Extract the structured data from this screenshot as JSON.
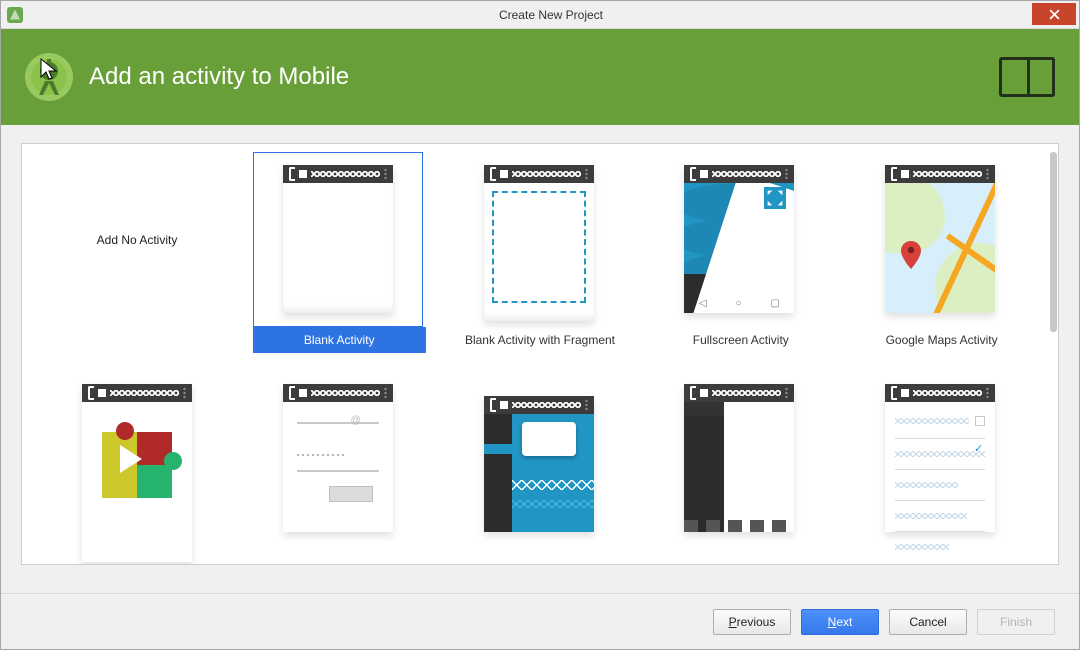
{
  "window": {
    "title": "Create New Project"
  },
  "banner": {
    "title": "Add an activity to Mobile"
  },
  "templates": {
    "row1": [
      {
        "id": "none",
        "label": "Add No Activity"
      },
      {
        "id": "blank",
        "label": "Blank Activity",
        "selected": true
      },
      {
        "id": "fragment",
        "label": "Blank Activity with Fragment"
      },
      {
        "id": "fullscreen",
        "label": "Fullscreen Activity"
      },
      {
        "id": "maps",
        "label": "Google Maps Activity"
      }
    ]
  },
  "footer": {
    "previous": "Previous",
    "next": "Next",
    "cancel": "Cancel",
    "finish": "Finish"
  }
}
